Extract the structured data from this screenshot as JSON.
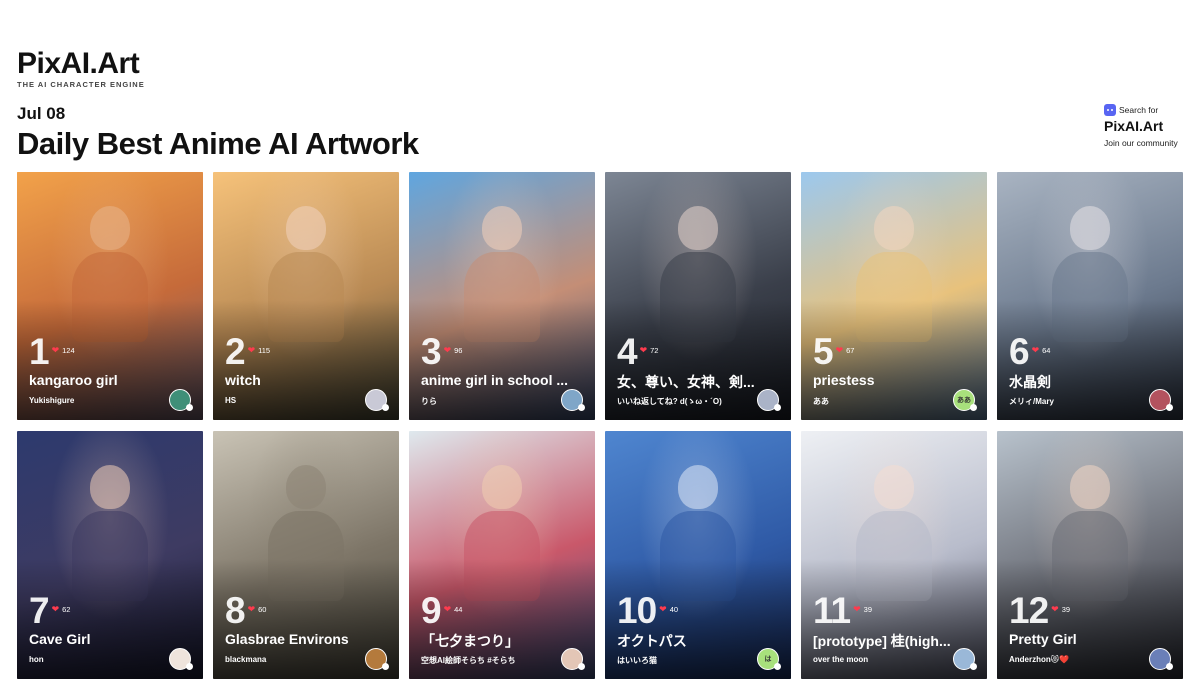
{
  "brand": {
    "name": "PixAI.Art",
    "tagline": "THE AI CHARACTER ENGINE"
  },
  "header": {
    "date": "Jul 08",
    "title": "Daily Best Anime AI Artwork"
  },
  "community": {
    "search_for": "Search for",
    "name": "PixAI.Art",
    "join": "Join our community",
    "icon": "discord-icon"
  },
  "colors": {
    "highlight": "#f59a3c",
    "heart": "#ff3b4e"
  },
  "cards": [
    {
      "rank": "1",
      "likes": "124",
      "title": "kangaroo girl",
      "author": "Yukishigure",
      "avatar_text": "",
      "bg": [
        "#f2a24a",
        "#c56a3a",
        "#6a5a6a"
      ],
      "skin": "#e8b48a",
      "avatar_bg": "#3f8f78",
      "highlight": true
    },
    {
      "rank": "2",
      "likes": "115",
      "title": "witch",
      "author": "HS",
      "avatar_text": "",
      "bg": [
        "#f6c27a",
        "#b98a54",
        "#4a4a38"
      ],
      "skin": "#f0d2be",
      "avatar_bg": "#c9c9d6",
      "highlight": false
    },
    {
      "rank": "3",
      "likes": "96",
      "title": "anime girl in school ...",
      "author": "りら",
      "avatar_text": "",
      "bg": [
        "#5fa6e0",
        "#c48e76",
        "#3b4e74"
      ],
      "skin": "#f2d0ba",
      "avatar_bg": "#7fa6c8",
      "highlight": false
    },
    {
      "rank": "4",
      "likes": "72",
      "title": "女、尊い、女神、剣...",
      "author": "いいね返してね? d(ゝω・´O)",
      "avatar_text": "",
      "bg": [
        "#7d8694",
        "#3a3f4a",
        "#1c1f27"
      ],
      "skin": "#e6d3cc",
      "avatar_bg": "#aab3c7",
      "highlight": false
    },
    {
      "rank": "5",
      "likes": "67",
      "title": "priestess",
      "author": "ああ",
      "avatar_text": "ああ",
      "bg": [
        "#9cc8ee",
        "#e8c27c",
        "#5f7fa0"
      ],
      "skin": "#f3d6c0",
      "avatar_bg": "#a8e07c",
      "highlight": false
    },
    {
      "rank": "6",
      "likes": "64",
      "title": "水晶剣",
      "author": "メリィ/Mary",
      "avatar_text": "",
      "bg": [
        "#a9b4c2",
        "#6c7a8e",
        "#323a48"
      ],
      "skin": "#e5e2e6",
      "avatar_bg": "#b3525e",
      "highlight": false
    },
    {
      "rank": "7",
      "likes": "62",
      "title": "Cave Girl",
      "author": "hon",
      "avatar_text": "",
      "bg": [
        "#2d3a6e",
        "#3e3b62",
        "#1b1c34"
      ],
      "skin": "#f0cdb8",
      "avatar_bg": "#efe4dc",
      "highlight": false
    },
    {
      "rank": "8",
      "likes": "60",
      "title": "Glasbrae Environs",
      "author": "blackmana",
      "avatar_text": "",
      "bg": [
        "#c9c3b5",
        "#7d7567",
        "#4d4a3e"
      ],
      "skin": "#8c8474",
      "avatar_bg": "#b47a3c",
      "highlight": false
    },
    {
      "rank": "9",
      "likes": "44",
      "title": "「七夕まつり」",
      "author": "空想AI絵師そらち #そらち",
      "avatar_text": "",
      "bg": [
        "#dfe9ee",
        "#c9586a",
        "#3e4e7c"
      ],
      "skin": "#f0cdb0",
      "avatar_bg": "#e3c6b6",
      "highlight": false
    },
    {
      "rank": "10",
      "likes": "40",
      "title": "オクトパス",
      "author": "はいいろ猫",
      "avatar_text": "は",
      "bg": [
        "#4f86d0",
        "#2f5aa6",
        "#1a2f62"
      ],
      "skin": "#dfe8f6",
      "avatar_bg": "#a8e07c",
      "highlight": false
    },
    {
      "rank": "11",
      "likes": "39",
      "title": "[prototype] 桂(high...",
      "author": "over the moon",
      "avatar_text": "",
      "bg": [
        "#eef0f4",
        "#b8bccb",
        "#5c5e70"
      ],
      "skin": "#f4ddd2",
      "avatar_bg": "#9ab8d8",
      "highlight": false
    },
    {
      "rank": "12",
      "likes": "39",
      "title": "Pretty Girl",
      "author": "Anderzhon😻❤️",
      "avatar_text": "",
      "bg": [
        "#b8c2cc",
        "#6c6f78",
        "#2e3038"
      ],
      "skin": "#f1d6c4",
      "avatar_bg": "#6a7fb8",
      "highlight": false
    }
  ]
}
